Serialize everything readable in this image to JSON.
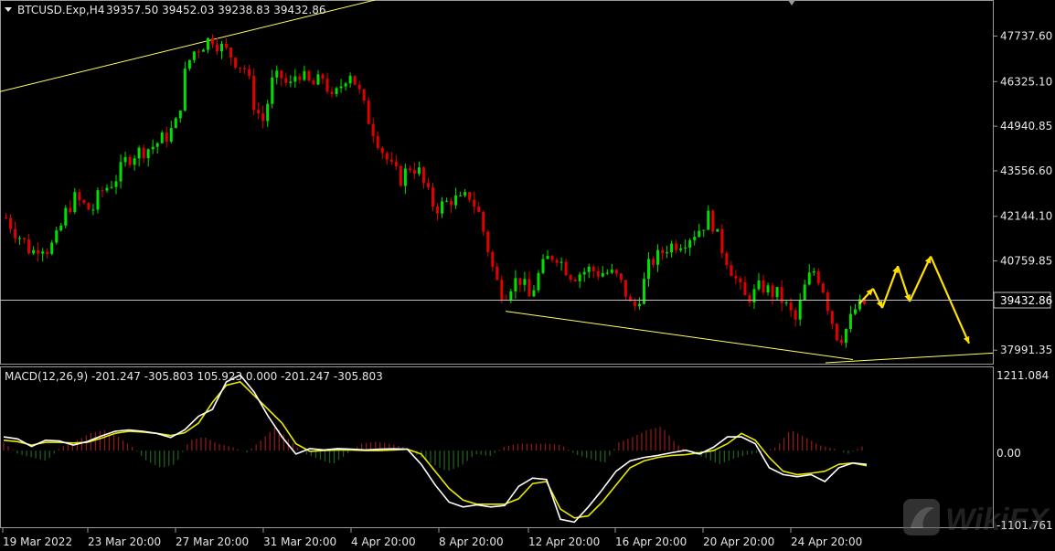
{
  "main_panel": {
    "symbol_header": "BTCUSD.Exp,H4",
    "ohlc_header": "39357.50 39452.03 39238.83 39432.86",
    "current_price_label": "39432.86",
    "current_price": 39432.86
  },
  "macd_panel": {
    "header": "MACD(12,26,9) -201.247 -305.803 105.923 0.000 -201.247 -305.803",
    "axis_labels": [
      "1211.084",
      "0.00",
      "-1101.761"
    ]
  },
  "watermark": {
    "text": "WikiFX"
  },
  "colors": {
    "background": "#000000",
    "bull_candle": "#00e000",
    "bear_candle": "#e00000",
    "price_line": "#c0c0c0",
    "trend_line": "#ffff66",
    "forecast_arrow": "#ffe000",
    "macd_line": "#ffffff",
    "signal_line": "#e8e800",
    "hist_positive": "#8b1a1a",
    "hist_negative": "#1f5e1f",
    "axis_text": "#e6e6e6"
  },
  "chart_data": [
    {
      "type": "candlestick",
      "title": "BTCUSD.Exp,H4",
      "y_ticks": [
        47737.6,
        46325.1,
        44940.85,
        43556.6,
        42144.1,
        40759.85,
        37991.35
      ],
      "y_tick_labels": [
        "47737.60",
        "46325.10",
        "44940.85",
        "43556.60",
        "42144.10",
        "40759.85",
        "37991.35"
      ],
      "ylim": [
        37600,
        48800
      ],
      "x_tick_labels": [
        "19 Mar 2022",
        "23 Mar 20:00",
        "27 Mar 20:00",
        "31 Mar 20:00",
        "4 Apr 20:00",
        "8 Apr 20:00",
        "12 Apr 20:00",
        "16 Apr 20:00",
        "20 Apr 20:00",
        "24 Apr 20:00"
      ],
      "close_path": [
        [
          0,
          42100
        ],
        [
          2,
          41700
        ],
        [
          4,
          41400
        ],
        [
          6,
          41000
        ],
        [
          8,
          41300
        ],
        [
          10,
          41100
        ],
        [
          12,
          41500
        ],
        [
          14,
          42300
        ],
        [
          16,
          42700
        ],
        [
          18,
          42500
        ],
        [
          20,
          42300
        ],
        [
          22,
          42900
        ],
        [
          24,
          43100
        ],
        [
          26,
          43400
        ],
        [
          28,
          43900
        ],
        [
          30,
          44100
        ],
        [
          32,
          44200
        ],
        [
          34,
          44300
        ],
        [
          36,
          44500
        ],
        [
          38,
          44700
        ],
        [
          40,
          45100
        ],
        [
          42,
          46800
        ],
        [
          44,
          47300
        ],
        [
          46,
          47500
        ],
        [
          48,
          47700
        ],
        [
          50,
          47400
        ],
        [
          52,
          47200
        ],
        [
          54,
          46900
        ],
        [
          56,
          46700
        ],
        [
          58,
          45500
        ],
        [
          60,
          45100
        ],
        [
          62,
          46300
        ],
        [
          64,
          46500
        ],
        [
          66,
          46100
        ],
        [
          68,
          46700
        ],
        [
          70,
          46300
        ],
        [
          72,
          46200
        ],
        [
          74,
          46500
        ],
        [
          76,
          45700
        ],
        [
          78,
          46200
        ],
        [
          80,
          46700
        ],
        [
          82,
          46100
        ],
        [
          84,
          45300
        ],
        [
          86,
          44700
        ],
        [
          88,
          44100
        ],
        [
          90,
          43600
        ],
        [
          92,
          43300
        ],
        [
          94,
          43700
        ],
        [
          96,
          43600
        ],
        [
          98,
          42900
        ],
        [
          100,
          42400
        ],
        [
          102,
          42500
        ],
        [
          104,
          42700
        ],
        [
          106,
          42600
        ],
        [
          108,
          42800
        ],
        [
          110,
          42300
        ],
        [
          112,
          41300
        ],
        [
          114,
          40200
        ],
        [
          116,
          39700
        ],
        [
          118,
          40100
        ],
        [
          120,
          40200
        ],
        [
          122,
          39600
        ],
        [
          124,
          40300
        ],
        [
          126,
          40800
        ],
        [
          128,
          41000
        ],
        [
          130,
          40600
        ],
        [
          132,
          40300
        ],
        [
          134,
          40400
        ],
        [
          136,
          40500
        ],
        [
          138,
          40400
        ],
        [
          140,
          40400
        ],
        [
          142,
          40300
        ],
        [
          144,
          39900
        ],
        [
          146,
          39200
        ],
        [
          148,
          39800
        ],
        [
          150,
          40700
        ],
        [
          152,
          40900
        ],
        [
          154,
          41200
        ],
        [
          156,
          41300
        ],
        [
          158,
          41400
        ],
        [
          160,
          41600
        ],
        [
          162,
          41800
        ],
        [
          164,
          42200
        ],
        [
          166,
          41400
        ],
        [
          168,
          40800
        ],
        [
          170,
          40200
        ],
        [
          172,
          39600
        ],
        [
          174,
          39700
        ],
        [
          176,
          40000
        ],
        [
          178,
          39800
        ],
        [
          180,
          39700
        ],
        [
          182,
          39300
        ],
        [
          184,
          38900
        ],
        [
          186,
          39900
        ],
        [
          188,
          40500
        ],
        [
          190,
          40100
        ],
        [
          192,
          39100
        ],
        [
          194,
          38300
        ],
        [
          196,
          38700
        ],
        [
          198,
          39300
        ],
        [
          200,
          39432.86
        ]
      ],
      "forecast_path": [
        [
          39432.86
        ],
        [
          39900
        ],
        [
          39300
        ],
        [
          40600
        ],
        [
          39500
        ],
        [
          40900
        ],
        [
          38200
        ]
      ],
      "trend_lines": [
        {
          "from": [
            40200,
            "start"
          ],
          "to": [
            48900,
            "top"
          ]
        },
        {
          "from": [
            39200,
            "12 Apr"
          ],
          "to": [
            37700,
            "24 Apr"
          ]
        },
        {
          "from": [
            37600,
            "25 Apr"
          ],
          "to": [
            37900,
            "end"
          ]
        }
      ]
    },
    {
      "type": "line",
      "title": "MACD(12,26,9)",
      "ylim": [
        -1101.761,
        1211.084
      ],
      "series": [
        {
          "name": "MACD",
          "values": [
            200,
            170,
            60,
            150,
            140,
            80,
            130,
            210,
            280,
            300,
            280,
            250,
            190,
            300,
            500,
            600,
            1000,
            1100,
            850,
            500,
            200,
            -50,
            30,
            10,
            30,
            20,
            10,
            20,
            25,
            20,
            -200,
            -500,
            -750,
            -820,
            -790,
            -820,
            -800,
            -520,
            -400,
            -420,
            -1000,
            -1040,
            -820,
            -570,
            -300,
            -150,
            -100,
            -70,
            -30,
            5,
            -50,
            50,
            200,
            200,
            100,
            -250,
            -350,
            -380,
            -350,
            -450,
            -250,
            -180,
            -200
          ]
        },
        {
          "name": "Signal",
          "values": [
            150,
            130,
            80,
            120,
            120,
            110,
            120,
            180,
            250,
            280,
            270,
            250,
            220,
            260,
            400,
            700,
            950,
            1000,
            800,
            600,
            400,
            100,
            -10,
            0,
            10,
            10,
            0,
            0,
            10,
            20,
            -50,
            -300,
            -550,
            -720,
            -780,
            -780,
            -780,
            -700,
            -480,
            -450,
            -850,
            -980,
            -950,
            -750,
            -500,
            -250,
            -150,
            -100,
            -70,
            -60,
            -30,
            0,
            100,
            250,
            150,
            -100,
            -300,
            -350,
            -330,
            -300,
            -200,
            -180,
            -220
          ]
        },
        {
          "name": "Histogram",
          "values": [
            120,
            -50,
            -100,
            -150,
            50,
            130,
            250,
            300,
            200,
            50,
            -150,
            -250,
            -200,
            150,
            200,
            100,
            50,
            -30,
            150,
            350,
            150,
            -40,
            -120,
            -200,
            -50,
            100,
            130,
            100,
            50,
            -80,
            -200,
            -300,
            -220,
            -50,
            -80,
            60,
            100,
            100,
            100,
            80,
            -60,
            -120,
            -180,
            120,
            200,
            300,
            350,
            100,
            -40,
            -100,
            -200,
            -120,
            -60,
            -20,
            50,
            300,
            200,
            80,
            30,
            -50,
            60
          ]
        }
      ]
    }
  ]
}
